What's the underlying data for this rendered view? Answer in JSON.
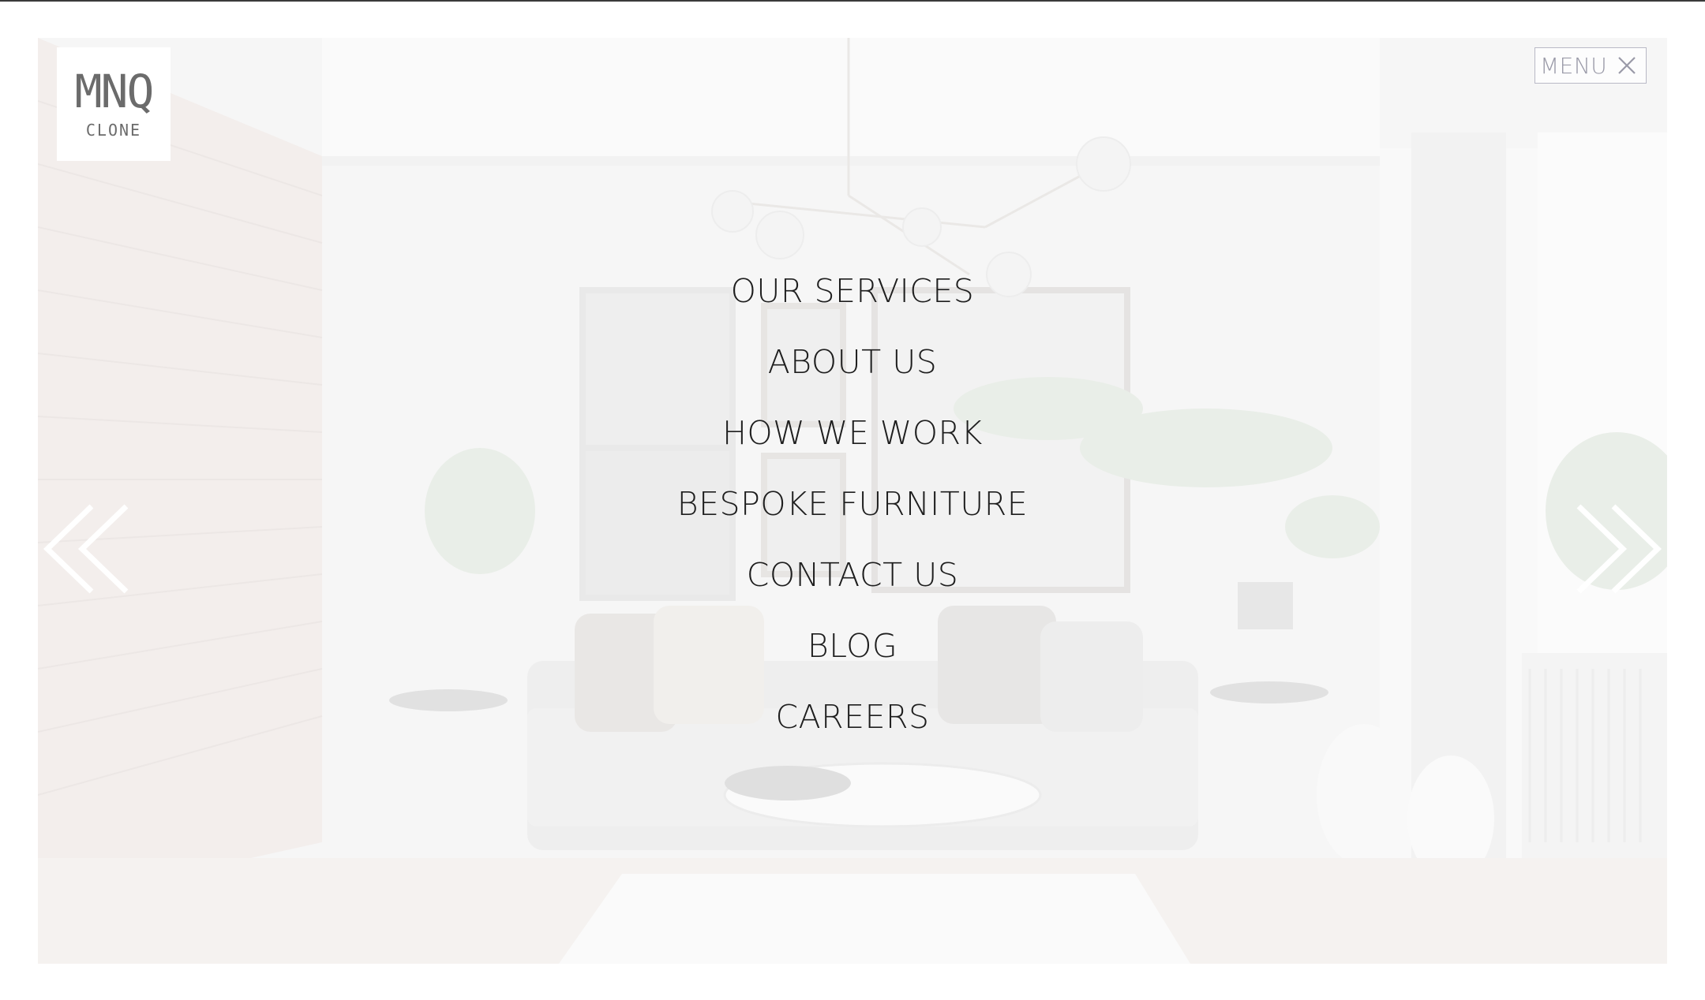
{
  "logo": {
    "mark": "MNQ",
    "sub": "CLONE"
  },
  "menu_button": {
    "label": "MENU",
    "icon": "close-icon"
  },
  "nav": {
    "items": [
      {
        "label": "OUR SERVICES"
      },
      {
        "label": "ABOUT US"
      },
      {
        "label": "HOW WE WORK"
      },
      {
        "label": "BESPOKE FURNITURE"
      },
      {
        "label": "CONTACT US"
      },
      {
        "label": "BLOG"
      },
      {
        "label": "CAREERS"
      }
    ]
  },
  "carousel": {
    "prev_icon": "double-chevron-left-icon",
    "next_icon": "double-chevron-right-icon"
  },
  "colors": {
    "nav_text": "#1e1e1e",
    "logo_text": "#6b6b6b",
    "menu_text": "#9a9aa8",
    "arrow": "#ffffff"
  }
}
